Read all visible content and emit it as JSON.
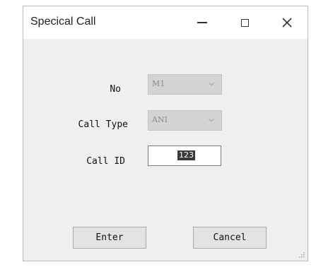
{
  "window": {
    "title": "Specical Call"
  },
  "titlebar_buttons": {
    "minimize_icon": "minimize-icon",
    "maximize_icon": "maximize-icon",
    "close_icon": "close-icon",
    "close_glyph": "✕"
  },
  "form": {
    "no_label": "No",
    "no_value": "M1",
    "call_type_label": "Call Type",
    "call_type_value": "ANI",
    "call_id_label": "Call ID",
    "call_id_value": "123"
  },
  "buttons": {
    "enter_label": "Enter",
    "cancel_label": "Cancel"
  },
  "colors": {
    "window_bg": "#efefef",
    "disabled_combo_bg": "#d3d3d3",
    "selection_bg": "#3a3a3a"
  }
}
